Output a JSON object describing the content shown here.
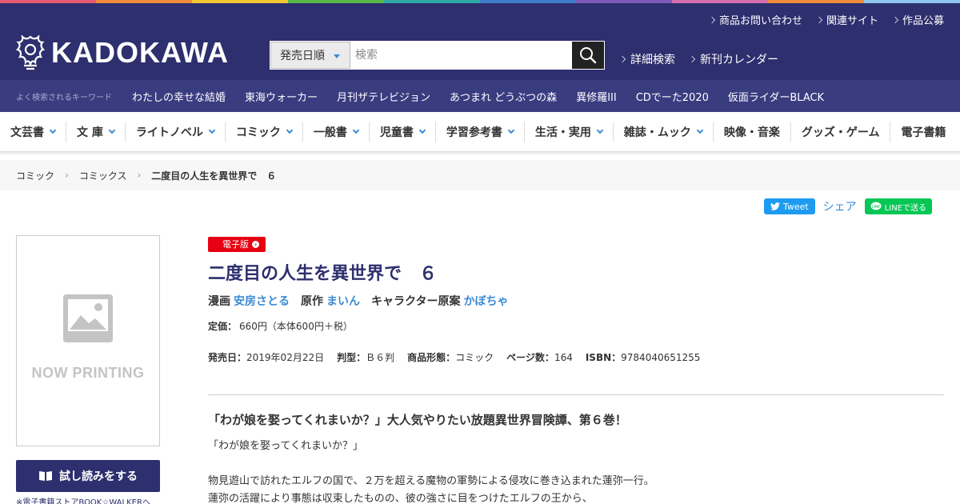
{
  "colors": {
    "brand_navy": "#2e2f6e",
    "keyword_bar": "#3a3c80",
    "link_blue": "#3a8ad6",
    "ebook_red": "#e60012",
    "rainbow": [
      "#e85a71",
      "#f08a3c",
      "#f3c632",
      "#58b947",
      "#2fa9a5",
      "#3e7cc8",
      "#7b5ab6",
      "#d66fb0",
      "#f08a3c",
      "#8ec6f0"
    ]
  },
  "header": {
    "logo_text": "KADOKAWA",
    "logo_icon": "phoenix-logo-icon",
    "top_links": [
      "商品お問い合わせ",
      "関連サイト",
      "作品公募"
    ],
    "search": {
      "select_value": "発売日順",
      "placeholder": "検索",
      "button_icon": "search-icon"
    },
    "links": [
      "詳細検索",
      "新刊カレンダー"
    ]
  },
  "keywords": {
    "label": "よく検索されるキーワード",
    "items": [
      "わたしの幸せな結婚",
      "東海ウォーカー",
      "月刊ザテレビジョン",
      "あつまれ どうぶつの森",
      "異修羅III",
      "CDでーた2020",
      "仮面ライダーBLACK"
    ]
  },
  "categories": [
    {
      "label": "文芸書",
      "dropdown": true
    },
    {
      "label": "文 庫",
      "dropdown": true
    },
    {
      "label": "ライトノベル",
      "dropdown": true
    },
    {
      "label": "コミック",
      "dropdown": true
    },
    {
      "label": "一般書",
      "dropdown": true
    },
    {
      "label": "児童書",
      "dropdown": true
    },
    {
      "label": "学習参考書",
      "dropdown": true
    },
    {
      "label": "生活・実用",
      "dropdown": true
    },
    {
      "label": "雑誌・ムック",
      "dropdown": true
    },
    {
      "label": "映像・音楽",
      "dropdown": false
    },
    {
      "label": "グッズ・ゲーム",
      "dropdown": false
    },
    {
      "label": "電子書籍",
      "dropdown": false
    }
  ],
  "breadcrumb": {
    "items": [
      "コミック",
      "コミックス"
    ],
    "current": "二度目の人生を異世界で　６"
  },
  "share": {
    "tweet": "Tweet",
    "share": "シェア",
    "line": "LINEで送る"
  },
  "cover": {
    "placeholder_text": "NOW PRINTING",
    "image_icon": "image-placeholder-icon"
  },
  "trial": {
    "button": "試し読みをする",
    "note": "※電子書籍ストアBOOK☆WALKERへ"
  },
  "product": {
    "badge": "電子版",
    "title": "二度目の人生を異世界で　６",
    "credits": [
      {
        "role": "漫画",
        "name": "安房さとる"
      },
      {
        "role": "原作",
        "name": "まいん"
      },
      {
        "role": "キャラクター原案",
        "name": "かぼちゃ"
      }
    ],
    "price_label": "定価：",
    "price_value": "660円（本体600円＋税）",
    "specs": [
      {
        "label": "発売日：",
        "value": "2019年02月22日"
      },
      {
        "label": "判型：",
        "value": "Ｂ６判"
      },
      {
        "label": "商品形態：",
        "value": "コミック"
      },
      {
        "label": "ページ数：",
        "value": "164"
      },
      {
        "label": "ISBN：",
        "value": "9784040651255"
      }
    ],
    "catchcopy": "「わが娘を娶ってくれまいか？」大人気やりたい放題異世界冒険譚、第６巻！",
    "description": [
      "「わが娘を娶ってくれまいか？」",
      "物見遊山で訪れたエルフの国で、２万を超える魔物の軍勢による侵攻に巻き込まれた蓮弥一行。",
      "蓮弥の活躍により事態は収束したものの、彼の強さに目をつけたエルフの王から、"
    ]
  }
}
